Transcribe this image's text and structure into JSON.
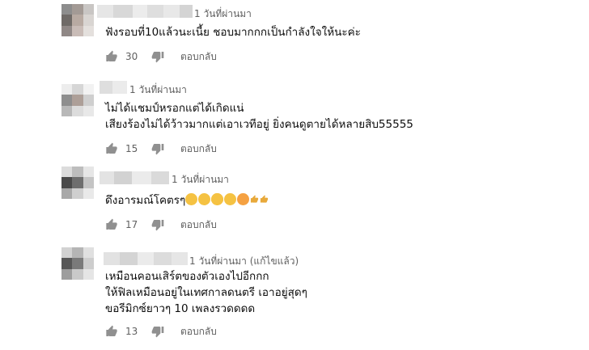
{
  "comments": [
    {
      "time": "1 วันที่ผ่านมา",
      "lines": [
        "ฟังรอบที่10แล้วนะเนี้ย ชอบมากกกเป็นกำลังใจให้นะค่ะ"
      ],
      "likes": "30",
      "reply_label": "ตอบกลับ"
    },
    {
      "time": "1 วันที่ผ่านมา",
      "lines": [
        "ไม่ได้แชมป์หรอกแต่ได้เกิดแน่",
        "เสียงร้องไม่ได้ว้าวมากแต่เอาเวทีอยู่ ยิ่งคนดูตายได้หลายสิบ55555"
      ],
      "likes": "15",
      "reply_label": "ตอบกลับ"
    },
    {
      "time": "1 วันที่ผ่านมา",
      "lines": [
        "ดึงอารมณ์โคตรๆ"
      ],
      "emojis": [
        "smiling-face-emoji",
        "smiling-face-emoji",
        "sunglasses-emoji",
        "sunglasses-emoji",
        "heart-eyes-emoji",
        "thumbs-up-emoji",
        "thumbs-up-emoji"
      ],
      "likes": "17",
      "reply_label": "ตอบกลับ"
    },
    {
      "time": "1 วันที่ผ่านมา (แก้ไขแล้ว)",
      "lines": [
        "เหมือนคอนเสิร์ตของตัวเองไปอีกกก",
        "ให้ฟิลเหมือนอยู่ในเทศกาลดนตรี เอาอยู่สุดๆ",
        "ขอรีมิกซ์ยาวๆ 10 เพลงรวดดดด"
      ],
      "likes": "13",
      "reply_label": "ตอบกลับ"
    }
  ],
  "colors": {
    "text": "#0d0d0d",
    "meta": "#606060",
    "icon": "#909090"
  }
}
